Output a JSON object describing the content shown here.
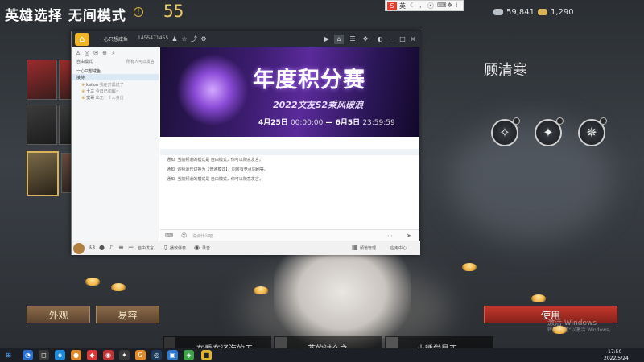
{
  "game": {
    "mode_title": "英雄选择 无间模式",
    "timer": "55",
    "currency_silver": "59,841",
    "currency_gold": "1,290",
    "hero_name": "顾清寒",
    "buttons": {
      "appearance": "外观",
      "face": "易容",
      "use": "使用"
    },
    "activate_windows": {
      "line1": "激活 Windows",
      "line2": "转到\"设置\"以激活 Windows。"
    },
    "bottom_players": [
      "在看在译海的无",
      "苔的讨么之",
      "小睡觉是正"
    ],
    "colors": {
      "gold": "#e6c76a",
      "use_red": "#c3382c",
      "btn_brown": "#8a6a4a"
    }
  },
  "chat": {
    "room_name": "一心只想咸鱼",
    "room_id": "1455471455",
    "sidebar": {
      "reception_mode": "自由模式",
      "welcome_note": "所有人可以发言",
      "channel_root": "一心只想咸鱼",
      "channel_selected": "接待",
      "users": [
        {
          "name": "kailou",
          "note": "我在开黑过了"
        },
        {
          "name": "十三",
          "note": "今日已和解~"
        },
        {
          "name": "宽哥",
          "note": "出无一个人身份"
        }
      ]
    },
    "banner": {
      "title": "年度积分赛",
      "subtitle": "2022文友S2乘风破浪",
      "date_start": "4月25日",
      "time_start": "00:00:00",
      "date_end": "6月5日",
      "time_end": "23:59:59"
    },
    "messages": [
      "通知: 当前频道的模式是 自由模式，你可以随意发言。",
      "通知: 该频道已切换为【普通模式】，同房有竞点同刷等。",
      "通知: 当前频道的模式是 自由模式，你可以随意发言。"
    ],
    "input_placeholder": "说点什么吧...",
    "bottom_bar": {
      "free_speech": "自由发言",
      "play_music": "播放伴奏",
      "record": "录音",
      "channel_settings": "频道管理",
      "app_center": "应用中心"
    }
  },
  "ime": {
    "lang": "英"
  },
  "taskbar": {
    "time": "17:50",
    "date": "2022/5/24"
  }
}
